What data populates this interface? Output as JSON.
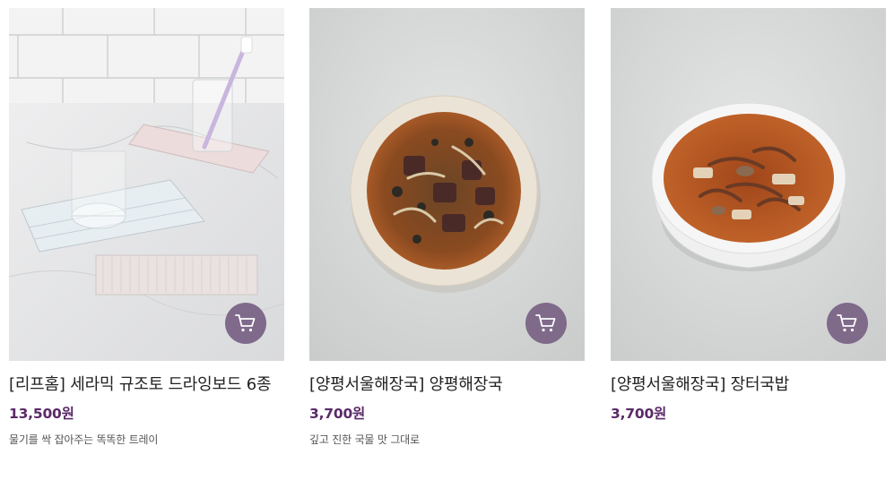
{
  "colors": {
    "price": "#5a2a68",
    "cart_button": "#7c6688",
    "name_text": "#222222",
    "desc_text": "#555555"
  },
  "products": [
    {
      "name": "[리프홈] 세라믹 규조토 드라잉보드 6종",
      "price": "13,500원",
      "description": "물기를 싹 잡아주는 똑똑한 트레이",
      "image": "ceramic-drying-boards-photo",
      "cart_icon": "shopping-cart-icon"
    },
    {
      "name": "[양평서울해장국] 양평해장국",
      "price": "3,700원",
      "description": "깊고 진한 국물 맛 그대로",
      "image": "hangover-soup-bowl-photo",
      "cart_icon": "shopping-cart-icon"
    },
    {
      "name": "[양평서울해장국] 장터국밥",
      "price": "3,700원",
      "description": "",
      "image": "beef-soup-bowl-photo",
      "cart_icon": "shopping-cart-icon"
    }
  ]
}
